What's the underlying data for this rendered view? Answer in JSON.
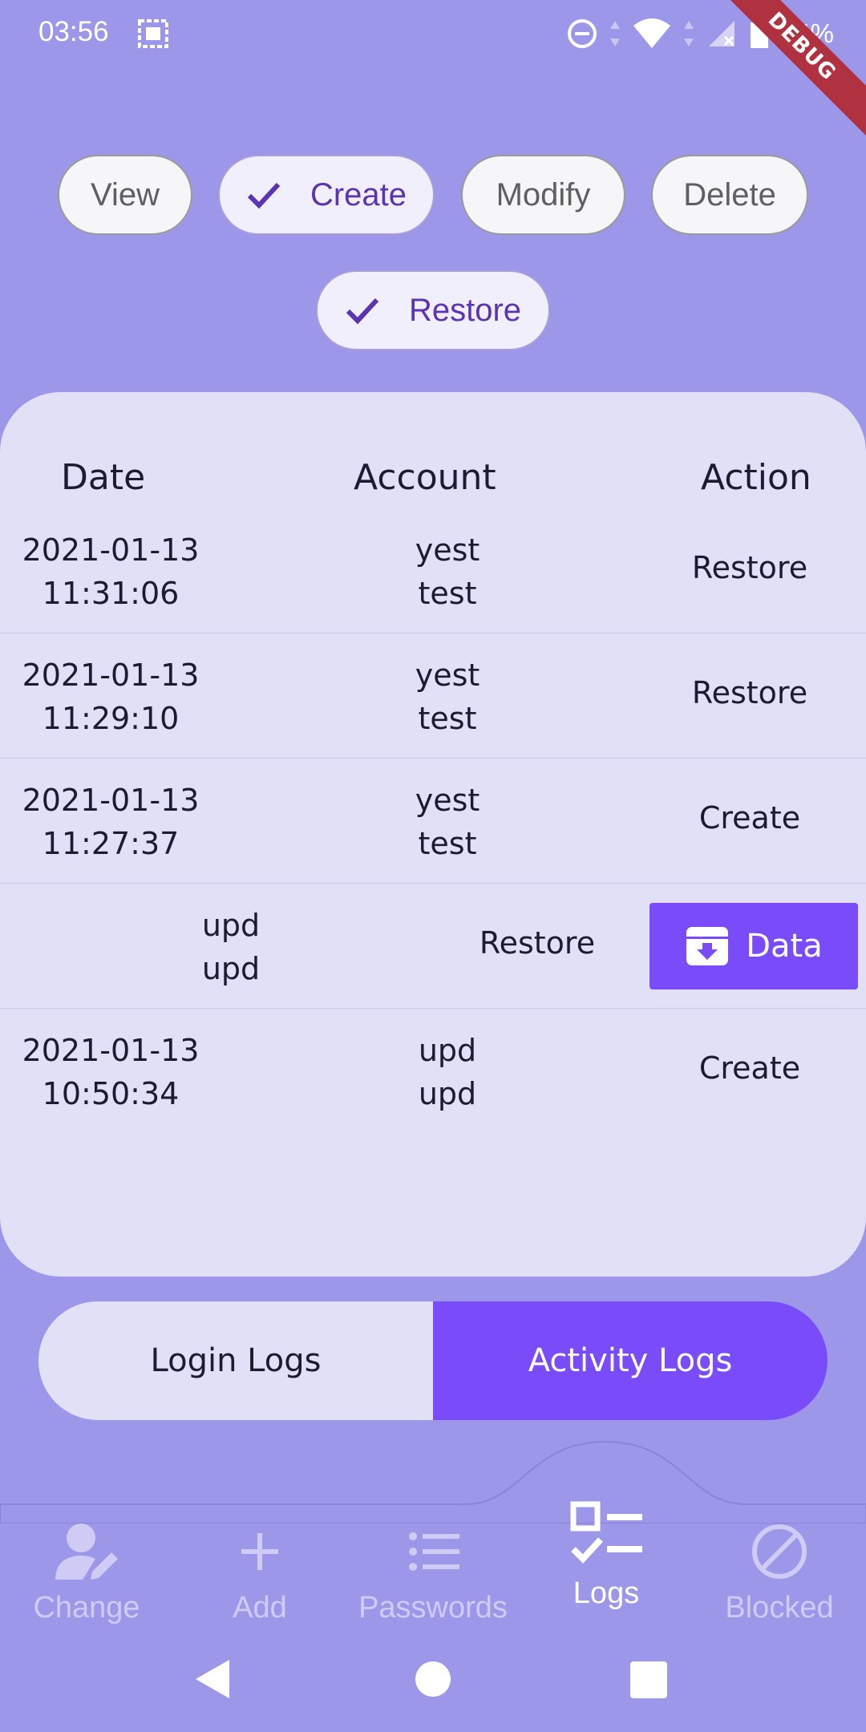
{
  "status": {
    "time": "03:56",
    "battery": "84%"
  },
  "debug_banner": "DEBUG",
  "filters": [
    {
      "label": "View",
      "selected": false
    },
    {
      "label": "Create",
      "selected": true
    },
    {
      "label": "Modify",
      "selected": false
    },
    {
      "label": "Delete",
      "selected": false
    },
    {
      "label": "Restore",
      "selected": true
    }
  ],
  "table": {
    "headers": {
      "date": "Date",
      "account": "Account",
      "action": "Action"
    },
    "rows": [
      {
        "date": "2021-01-13",
        "time": "11:31:06",
        "account_line1": "yest",
        "account_line2": "test",
        "action": "Restore"
      },
      {
        "date": "2021-01-13",
        "time": "11:29:10",
        "account_line1": "yest",
        "account_line2": "test",
        "action": "Restore"
      },
      {
        "date": "2021-01-13",
        "time": "11:27:37",
        "account_line1": "yest",
        "account_line2": "test",
        "action": "Create"
      },
      {
        "account_line1": "upd",
        "account_line2": "upd",
        "action": "Restore",
        "swipe_action_label": "Data"
      },
      {
        "date": "2021-01-13",
        "time": "10:50:34",
        "account_line1": "upd",
        "account_line2": "upd",
        "action": "Create"
      }
    ]
  },
  "log_tabs": {
    "login": "Login Logs",
    "activity": "Activity Logs",
    "active": "activity"
  },
  "bottom_nav": [
    {
      "label": "Change",
      "icon": "person-edit-icon"
    },
    {
      "label": "Add",
      "icon": "plus-icon"
    },
    {
      "label": "Passwords",
      "icon": "list-icon"
    },
    {
      "label": "Logs",
      "icon": "checklist-icon",
      "active": true
    },
    {
      "label": "Blocked",
      "icon": "block-icon"
    }
  ],
  "colors": {
    "background": "#9d97e9",
    "card": "#e2e0f7",
    "accent": "#7a4cf9",
    "chip_selected_text": "#5b33b5"
  }
}
